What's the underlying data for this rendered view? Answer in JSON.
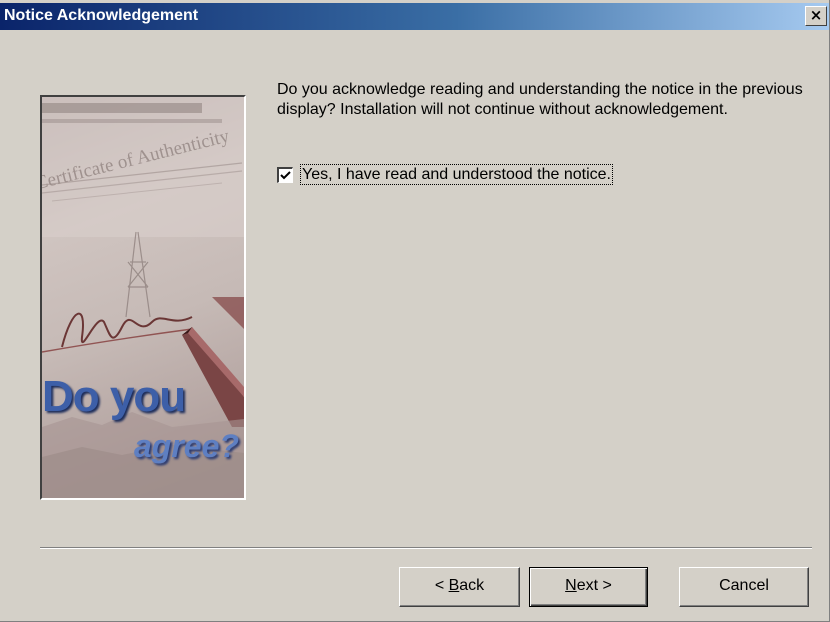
{
  "window": {
    "title": "Notice Acknowledgement",
    "close_glyph": "×"
  },
  "banner": {
    "line1": "Do you",
    "line2": "agree?",
    "certificate_text": "Certificate of Authenticity",
    "certificate_top_text": "CER"
  },
  "content": {
    "question": "Do you acknowledge reading and understanding the notice in the previous display? Installation will not continue without acknowledgement.",
    "checkbox": {
      "label": "Yes, I have read and understood the notice.",
      "checked": true
    }
  },
  "buttons": {
    "back": {
      "prefix": "< ",
      "mnemonic": "B",
      "rest": "ack"
    },
    "next": {
      "mnemonic": "N",
      "rest": "ext >"
    },
    "cancel": {
      "label": "Cancel"
    }
  },
  "colors": {
    "title_start": "#0a246a",
    "title_end": "#a6caf0",
    "face": "#d4d0c8",
    "banner_text": "#3d5fa8"
  }
}
